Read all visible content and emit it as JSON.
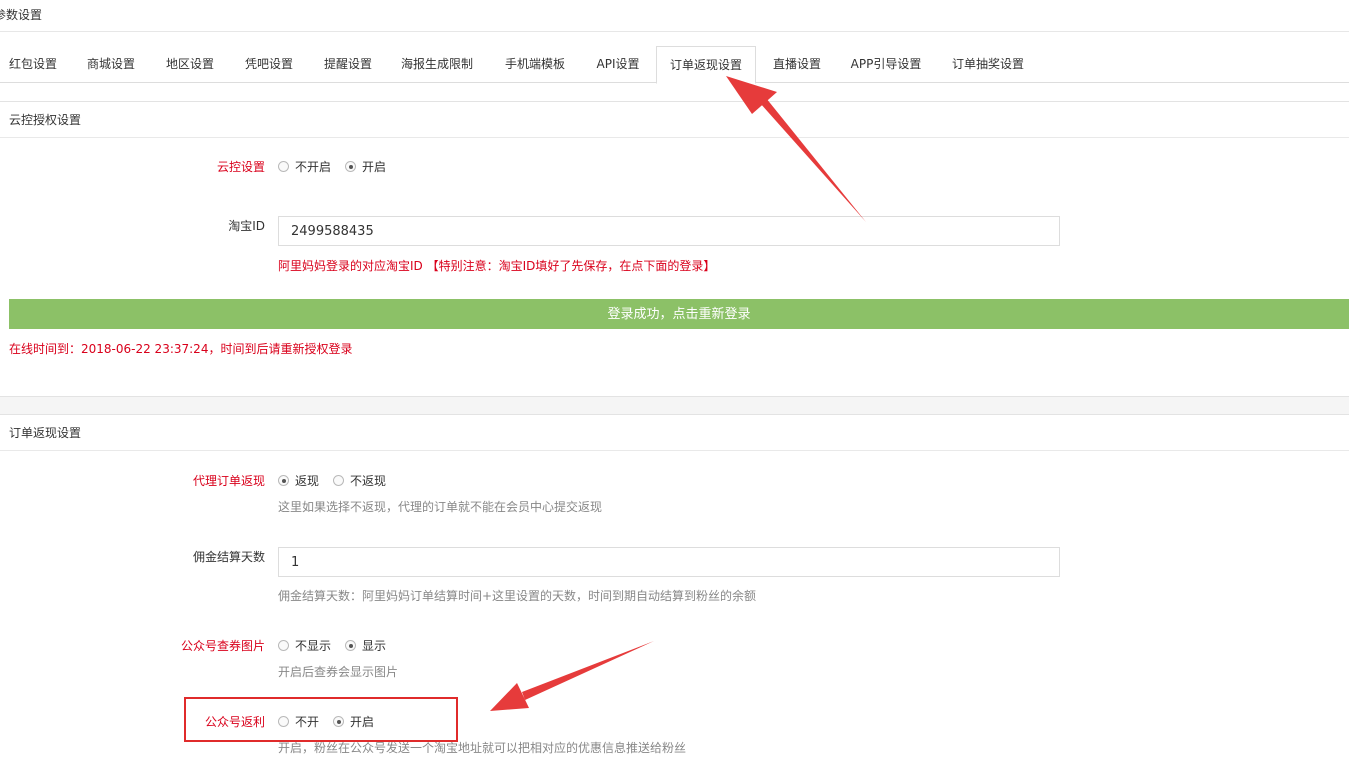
{
  "page": {
    "title": "参数设置"
  },
  "tabs": [
    {
      "label": "红包设置"
    },
    {
      "label": "商城设置"
    },
    {
      "label": "地区设置"
    },
    {
      "label": "凭吧设置"
    },
    {
      "label": "提醒设置"
    },
    {
      "label": "海报生成限制"
    },
    {
      "label": "手机端模板"
    },
    {
      "label": "API设置"
    },
    {
      "label": "订单返现设置"
    },
    {
      "label": "直播设置"
    },
    {
      "label": "APP引导设置"
    },
    {
      "label": "订单抽奖设置"
    }
  ],
  "cloud": {
    "header": "云控授权设置",
    "setting_label": "云控设置",
    "opt_off": "不开启",
    "opt_on": "开启",
    "taobao_label": "淘宝ID",
    "taobao_value": "2499588435",
    "taobao_help": "阿里妈妈登录的对应淘宝ID 【特别注意：淘宝ID填好了先保存，在点下面的登录】",
    "login_button": "登录成功，点击重新登录",
    "online_note": "在线时间到：2018-06-22 23:37:24，时间到后请重新授权登录"
  },
  "order": {
    "header": "订单返现设置",
    "agent_label": "代理订单返现",
    "agent_opt_yes": "返现",
    "agent_opt_no": "不返现",
    "agent_help": "这里如果选择不返现，代理的订单就不能在会员中心提交返现",
    "days_label": "佣金结算天数",
    "days_value": "1",
    "days_help": "佣金结算天数：阿里妈妈订单结算时间+这里设置的天数，时间到期自动结算到粉丝的余额",
    "img_label": "公众号查券图片",
    "img_opt_hide": "不显示",
    "img_opt_show": "显示",
    "img_help": "开启后查券会显示图片",
    "rebate_label": "公众号返利",
    "rebate_opt_off": "不开",
    "rebate_opt_on": "开启",
    "rebate_help": "开启，粉丝在公众号发送一个淘宝地址就可以把相对应的优惠信息推送给粉丝"
  },
  "colors": {
    "accent_red": "#d9001b",
    "button_green": "#8cc167",
    "annotation_red": "#e02b2b"
  }
}
